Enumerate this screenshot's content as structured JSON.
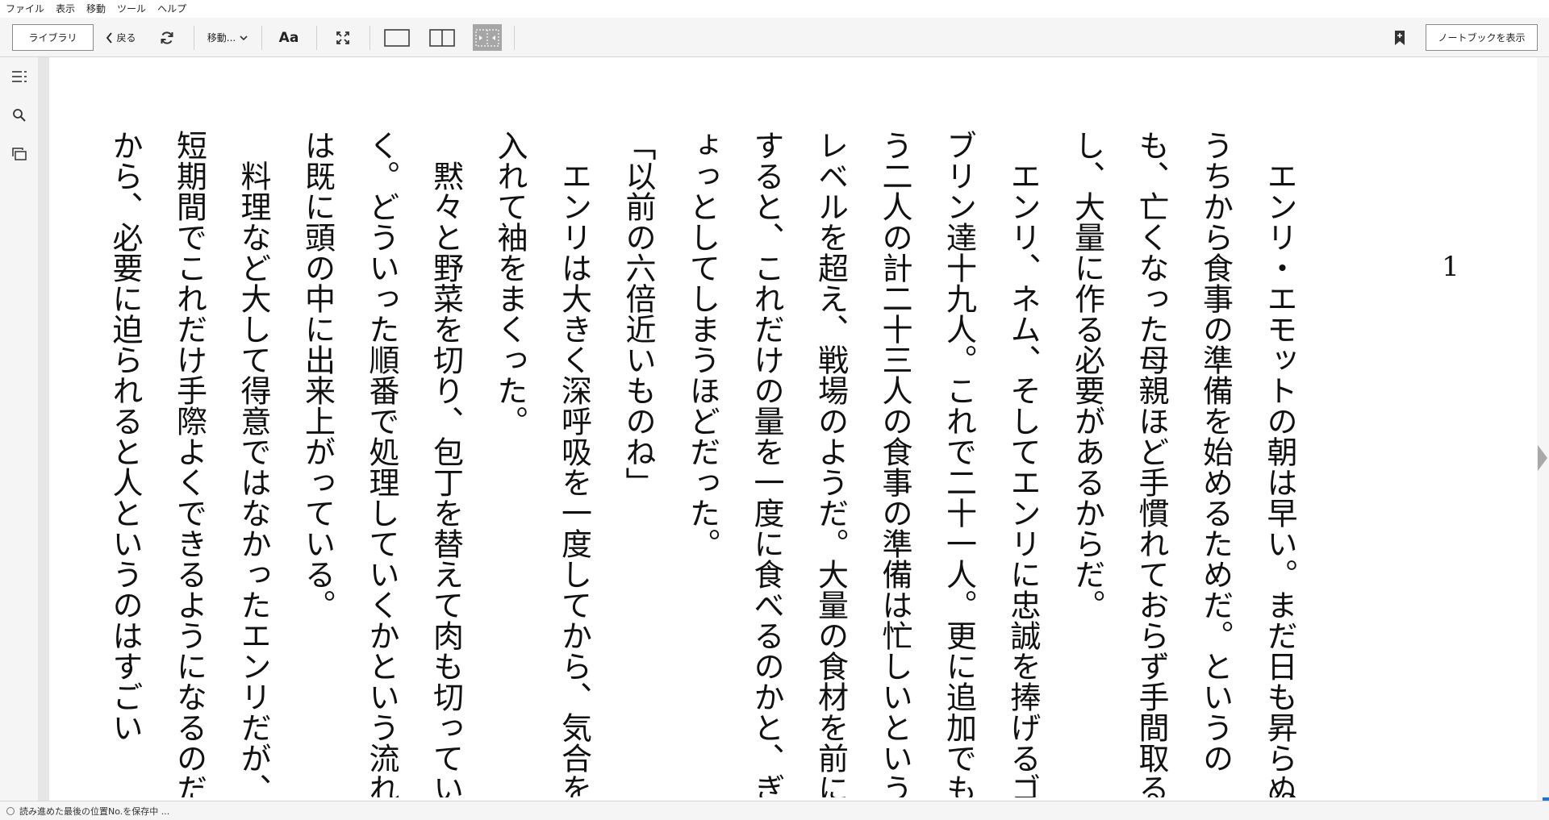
{
  "menu": [
    "ファイル",
    "表示",
    "移動",
    "ツール",
    "ヘルプ"
  ],
  "toolbar": {
    "library_label": "ライブラリ",
    "back_label": "戻る",
    "goto_label": "移動...",
    "font_label": "Aa",
    "notebook_label": "ノートブックを表示"
  },
  "book": {
    "chapter_number": "1",
    "paragraphs": [
      "エンリ・エモットの朝は早い。まだ日も昇らぬうちから食事の準備を始めるためだ。というのも、亡くなった母親ほど手慣れておらず手間取るし、大量に作る必要があるからだ。",
      "エンリ、ネム、そしてエンリに忠誠を捧げるゴブリン達十九人。これで二十一人。更に追加でもう二人の計二十三人の食事の準備は忙しいというレベルを超え、戦場のようだ。大量の食材を前にすると、これだけの量を一度に食べるのかと、ぎょっとしてしまうほどだった。",
      "「以前の六倍近いものね」",
      "エンリは大きく深呼吸を一度してから、気合を入れて袖をまくった。",
      "黙々と野菜を切り、包丁を替えて肉も切っていく。どういった順番で処理していくかという流れは既に頭の中に出来上がっている。",
      "料理など大して得意ではなかったエンリだが、短期間でこれだけ手際よくできるようになるのだから、必要に迫られると人というのはすごい"
    ]
  },
  "status": {
    "text": "読み進めた最後の位置No.を保存中 ..."
  }
}
